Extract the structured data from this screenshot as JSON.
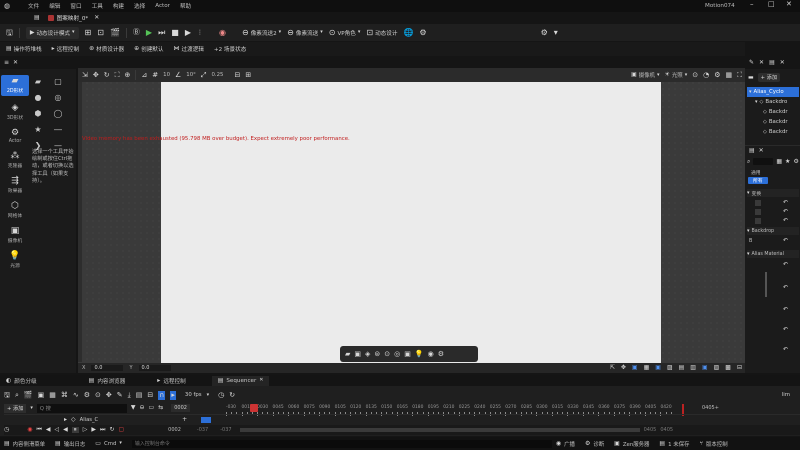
{
  "app": {
    "title": "Motion074"
  },
  "menu": {
    "items": [
      "文件",
      "编辑",
      "窗口",
      "工具",
      "构建",
      "选择",
      "Actor",
      "帮助"
    ]
  },
  "tab": {
    "label": "图案映射_0*"
  },
  "toolbar": {
    "mode": "动态设计模式",
    "pattern_tool2": "像素流送2",
    "pixel_streaming": "像素流送",
    "vp_role": "VP角色",
    "motion_design": "动态设计"
  },
  "toolbar2": {
    "actor_panel": "操作符堆栈",
    "remote_control": "远程控制",
    "material_designer": "材质设计器",
    "create_default": "创建默认",
    "transition_logic": "过渡逻辑",
    "scene_state": "+2 场景状态"
  },
  "left_panel": {
    "modes": [
      {
        "label": "2D形状"
      },
      {
        "label": "3D形状"
      },
      {
        "label": "Actor"
      },
      {
        "label": "克隆器"
      },
      {
        "label": "效果器"
      },
      {
        "label": "网格体"
      },
      {
        "label": "摄像机"
      },
      {
        "label": "光源"
      }
    ],
    "hint": "选择一个工具开始绘制或按住Ctrl拖动，或者切换以选择工具（如果支持）。"
  },
  "viewport": {
    "toolbar": {
      "snap1": "10",
      "snap2": "10°",
      "snap3": "0.25",
      "camera": "摄像机",
      "lit": "光照"
    },
    "warning": "Video memory has been exhausted (95.798 MB over budget). Expect extremely poor performance.",
    "x_value": "0.0",
    "y_value": "0.0"
  },
  "right_panel": {
    "add_label": "+ 添加",
    "outliner": [
      {
        "label": "Alias_Cyclo"
      },
      {
        "label": "Backdro"
      },
      {
        "label": "Backdr"
      },
      {
        "label": "Backdr"
      },
      {
        "label": "Backdr"
      }
    ],
    "details": {
      "filter_general": "通用",
      "filter_all": "所有",
      "section_transform": "变换",
      "section_backdrop": "Backdrop",
      "section_material": "Alias Material",
      "label_b": "B"
    }
  },
  "bottom_tabs": [
    {
      "label": "颜色分级"
    },
    {
      "label": "内容浏览器"
    },
    {
      "label": "远程控制"
    },
    {
      "label": "Sequencer"
    }
  ],
  "sequencer": {
    "add_label": "+ 添加",
    "search_placeholder": "Q 搜",
    "fps": "30 fps",
    "current_frame": "0002",
    "track_name": "Alias_C",
    "start_frame": "-037",
    "end_frame": "0405",
    "play_frame": "0002",
    "range_start": "-037",
    "range_end": "0405",
    "ruler": [
      "-030",
      "0015",
      "0030",
      "0045",
      "0060",
      "0075",
      "0090",
      "0105",
      "0120",
      "0135",
      "0150",
      "0165",
      "0180",
      "0195",
      "0210",
      "0225",
      "0240",
      "0255",
      "0270",
      "0285",
      "0300",
      "0315",
      "0330",
      "0345",
      "0360",
      "0375",
      "0390",
      "0405",
      "0420"
    ],
    "end_marker": "0405+"
  },
  "status": {
    "content_drawer": "内容侧滑菜单",
    "output_log": "输出日志",
    "cmd": "Cmd",
    "console_placeholder": "输入控制台命令",
    "broadcast": "广播",
    "derived_data": "诊断",
    "zen": "Zen服务器",
    "source_control": "1 未保存",
    "revision_control": "版本控制"
  }
}
